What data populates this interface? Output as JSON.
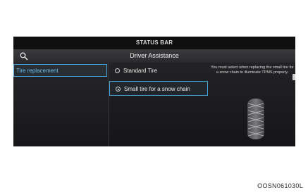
{
  "status_bar": {
    "label": "STATUS BAR"
  },
  "header": {
    "title": "Driver Assistance",
    "search_icon": "search-icon"
  },
  "sidebar": {
    "items": [
      {
        "label": "Tire replacement",
        "selected": true
      }
    ]
  },
  "options": [
    {
      "label": "Standard Tire",
      "selected": false
    },
    {
      "label": "Small tire for a snow chain",
      "selected": true
    }
  ],
  "help": {
    "text": "You must select when replacing the small tire for a snow chain to illuminate TPMS properly."
  },
  "figure_code": "OOSN061030L",
  "colors": {
    "accent": "#4aa5d6",
    "background": "#1c1c1e"
  }
}
